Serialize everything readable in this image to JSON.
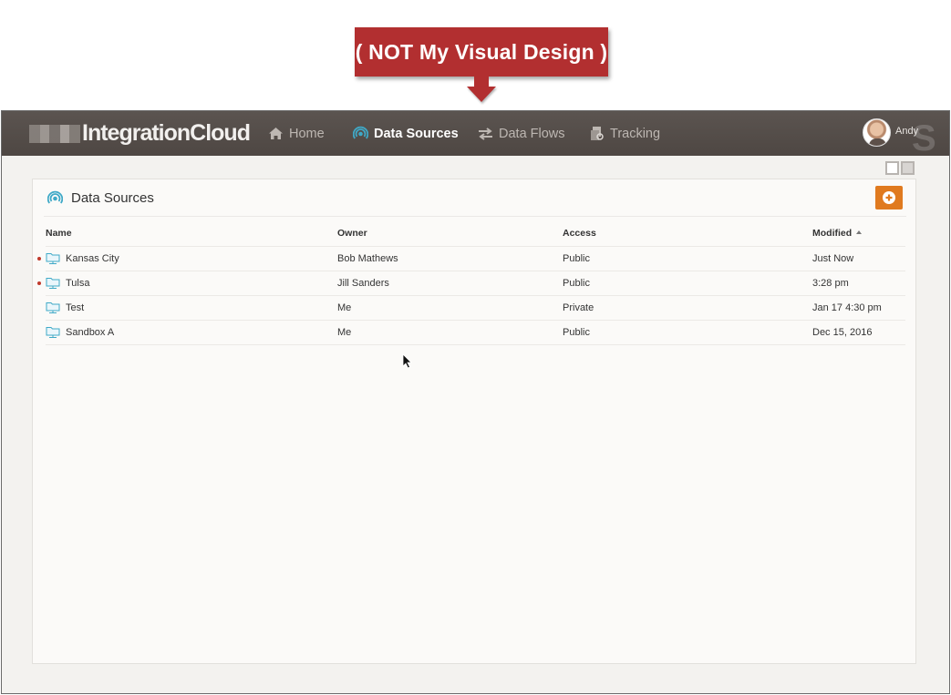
{
  "annotation": {
    "text": "( NOT My Visual Design )",
    "color": "#b22f30"
  },
  "app": {
    "logo_text": "IntegrationCloud",
    "nav": [
      {
        "label": "Home",
        "icon": "home-icon",
        "active": false
      },
      {
        "label": "Data Sources",
        "icon": "data-sources-icon",
        "active": true
      },
      {
        "label": "Data Flows",
        "icon": "data-flows-icon",
        "active": false
      },
      {
        "label": "Tracking",
        "icon": "tracking-icon",
        "active": false
      }
    ],
    "user": {
      "name": "Andy"
    },
    "colors": {
      "topbar": "#524b47",
      "accent": "#3fa9c7",
      "add_button": "#e07a1f",
      "unread_dot": "#c0392b"
    }
  },
  "panel": {
    "title": "Data Sources",
    "columns": {
      "name": "Name",
      "owner": "Owner",
      "access": "Access",
      "modified": "Modified"
    },
    "sort": {
      "column": "Modified",
      "direction": "ascending"
    },
    "rows": [
      {
        "name": "Kansas City",
        "owner": "Bob Mathews",
        "access": "Public",
        "modified": "Just Now",
        "unread": true
      },
      {
        "name": "Tulsa",
        "owner": "Jill Sanders",
        "access": "Public",
        "modified": "3:28 pm",
        "unread": true
      },
      {
        "name": "Test",
        "owner": "Me",
        "access": "Private",
        "modified": "Jan 17 4:30 pm",
        "unread": false
      },
      {
        "name": "Sandbox A",
        "owner": "Me",
        "access": "Public",
        "modified": "Dec 15, 2016",
        "unread": false
      }
    ]
  }
}
